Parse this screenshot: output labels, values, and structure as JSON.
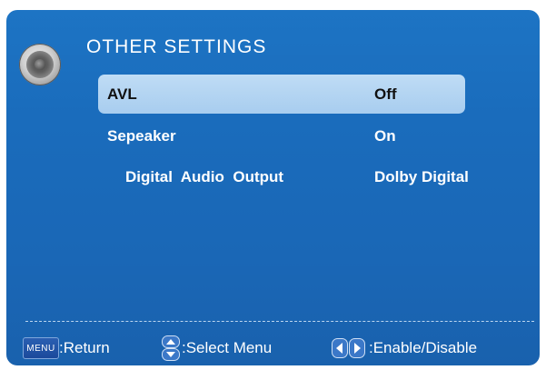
{
  "menu": {
    "title": "OTHER SETTINGS",
    "icon": "speaker-icon",
    "items": [
      {
        "label": "AVL",
        "value": "Off",
        "selected": true
      },
      {
        "label": "Sepeaker",
        "value": "On",
        "selected": false
      },
      {
        "label": "Digital  Audio  Output",
        "value": "Dolby Digital",
        "selected": false
      }
    ]
  },
  "footer": {
    "menu_key": "MENU",
    "return_label": ":Return",
    "select_label": ":Select Menu",
    "enable_label": ":Enable/Disable"
  },
  "colors": {
    "background": "#1a6cbc",
    "highlight": "#b3d4f2",
    "text": "#ffffff"
  }
}
